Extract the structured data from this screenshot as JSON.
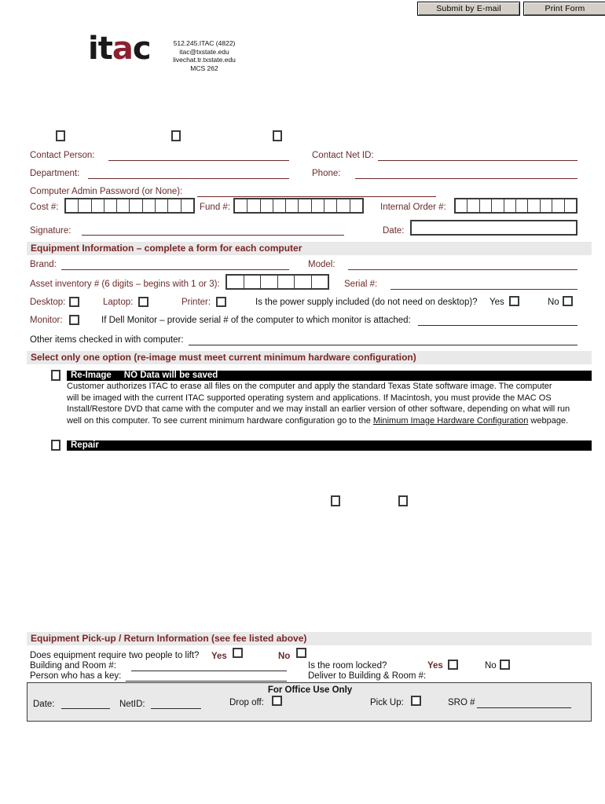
{
  "toolbar": {
    "submit_label": "Submit by E-mail",
    "print_label": "Print Form"
  },
  "logo": {
    "text_it": "it",
    "text_a": "a",
    "text_c": "c",
    "phone": "512.245.ITAC (4822)",
    "email": "itac@txstate.edu",
    "livechat": "livechat.tr.txstate.edu",
    "room": "MCS 262"
  },
  "contact": {
    "contact_person_label": "Contact Person:",
    "contact_netid_label": "Contact Net ID:",
    "department_label": "Department:",
    "phone_label": "Phone:",
    "admin_password_label": "Computer Admin Password (or None):",
    "cost_label": "Cost #:",
    "fund_label": "Fund #:",
    "internal_order_label": "Internal Order #:",
    "signature_label": "Signature:",
    "date_label": "Date:",
    "cost_cells": 10,
    "fund_cells": 10,
    "internal_order_cells": 10,
    "contact_person_value": "",
    "contact_netid_value": "",
    "department_value": "",
    "phone_value": "",
    "signature_value": "",
    "date_value": ""
  },
  "equipment": {
    "section_title": "Equipment Information – complete a form for each computer",
    "brand_label": "Brand:",
    "model_label": "Model:",
    "asset_label": "Asset inventory # (6 digits – begins with 1 or 3):",
    "asset_cells": 6,
    "serial_label": "Serial #:",
    "desktop_label": "Desktop:",
    "laptop_label": "Laptop:",
    "printer_label": "Printer:",
    "power_supply_question": "Is the power supply included (do not need on desktop)?",
    "yes_label": "Yes",
    "no_label": "No",
    "monitor_label": "Monitor:",
    "dell_monitor_label": "If Dell Monitor – provide serial # of the computer to which monitor is attached:",
    "other_items_label": "Other items checked in with computer:"
  },
  "options": {
    "section_title": "Select only one option (re-image must meet current minimum hardware configuration)",
    "reimage_title": "Re-Image",
    "reimage_warning": "NO Data will be saved",
    "reimage_body_1": "Customer authorizes ITAC to erase all files on the computer and apply the standard Texas State software image.  The computer",
    "reimage_body_2": "will be imaged with the current ITAC supported operating system and applications.  If Macintosh, you must provide the MAC OS",
    "reimage_body_3": "Install/Restore DVD that came with the computer and we may install an earlier version of other software, depending on what will run",
    "reimage_body_4_pre": "well on this computer.  To see current minimum hardware configuration go to the ",
    "reimage_body_4_link": "Minimum Image Hardware Configuration",
    "reimage_body_4_post": " webpage.",
    "repair_title": "Repair"
  },
  "pickup": {
    "section_title": "Equipment Pick-up / Return Information (see fee listed above)",
    "two_people_question": "Does equipment require two people to lift?",
    "yes_label": "Yes",
    "no_label": "No",
    "building_room_label": "Building and Room #:",
    "room_locked_question": "Is the room locked?",
    "key_person_label": "Person who has a key:",
    "deliver_label": "Deliver to Building & Room #:"
  },
  "office": {
    "title": "For Office Use Only",
    "date_label": "Date:",
    "netid_label": "NetID:",
    "dropoff_label": "Drop off:",
    "pickup_label": "Pick Up:",
    "sro_label": "SRO #"
  },
  "colors": {
    "maroon_text": "#6b2a2a",
    "header_maroon": "#7b2424",
    "section_bg": "#e9e9e9",
    "logo_accent": "#8b2230",
    "black_bar": "#000000"
  }
}
